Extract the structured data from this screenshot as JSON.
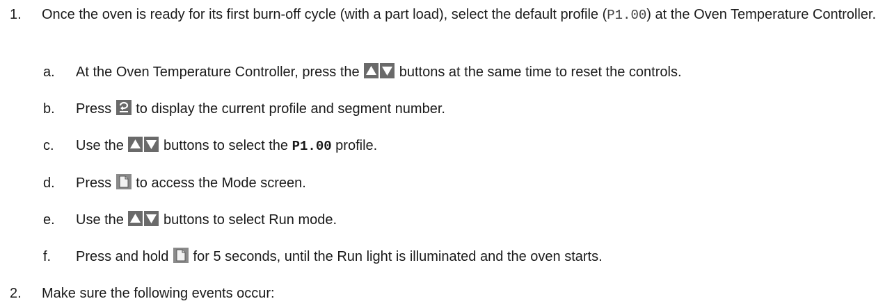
{
  "steps": [
    {
      "number": "1.",
      "text_before": "Once the oven is ready for its first burn-off cycle (with a part load), select the default profile (",
      "code": "P1.00",
      "text_after": ") at the Oven Temperature Controller.",
      "substeps": [
        {
          "letter": "a.",
          "before": "At the Oven Temperature Controller, press the ",
          "icon": "up-down-arrows-icon",
          "after": " buttons at the same time to reset the controls."
        },
        {
          "letter": "b.",
          "before": "Press ",
          "icon": "scroll-button-icon",
          "after": " to display the current profile and segment number."
        },
        {
          "letter": "c.",
          "before": "Use the ",
          "icon": "up-down-arrows-icon",
          "middle": " buttons to select the ",
          "code": "P1.00",
          "after": " profile."
        },
        {
          "letter": "d.",
          "before": "Press ",
          "icon": "page-button-icon",
          "after": " to access the Mode screen."
        },
        {
          "letter": "e.",
          "before": "Use the ",
          "icon": "up-down-arrows-icon",
          "after": " buttons to select Run mode."
        },
        {
          "letter": "f.",
          "before": "Press and hold ",
          "icon": "page-button-icon",
          "after": " for 5 seconds, until the Run light is illuminated and the oven starts."
        }
      ]
    },
    {
      "number": "2.",
      "text": "Make sure the following events occur:"
    }
  ]
}
